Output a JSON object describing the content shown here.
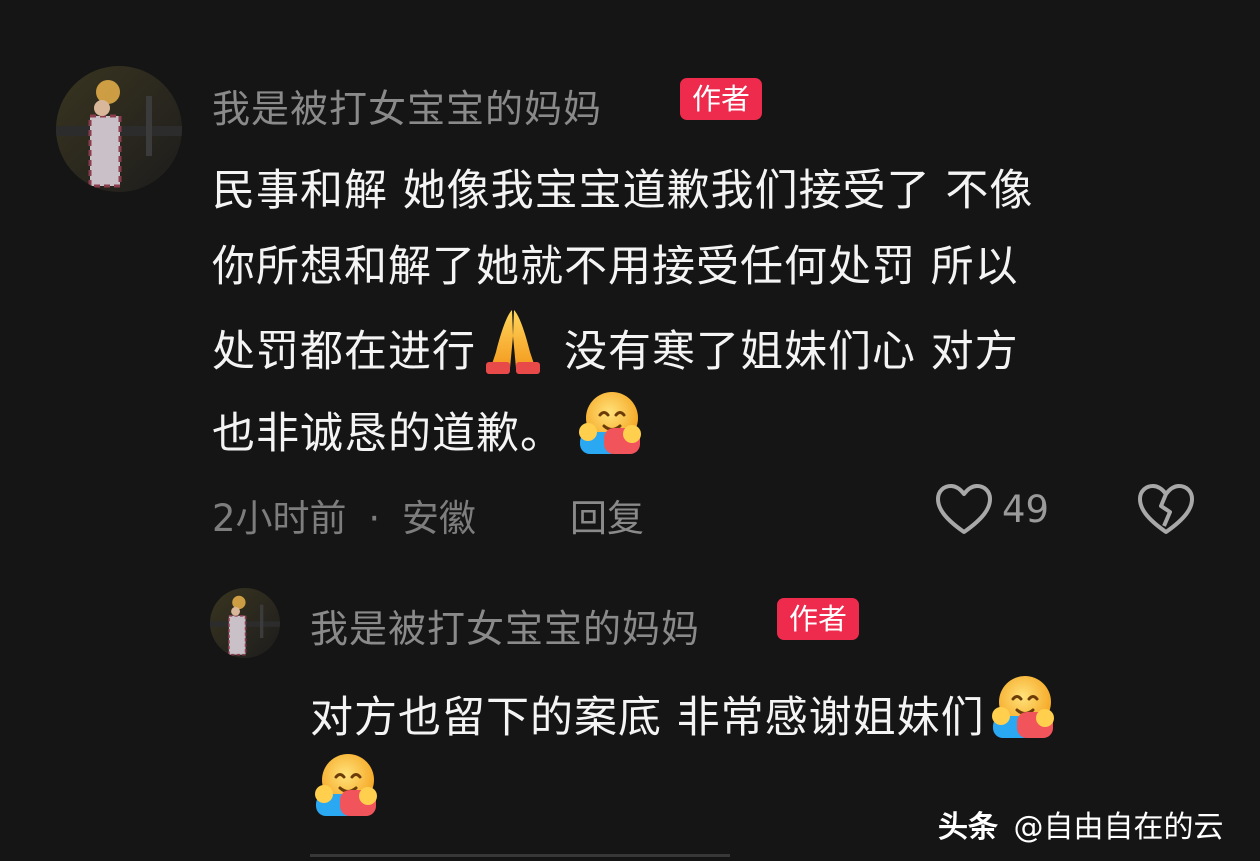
{
  "comment": {
    "username": "我是被打女宝宝的妈妈",
    "badge": "作者",
    "lines": [
      "民事和解 她像我宝宝道歉我们接受了 不像",
      "你所想和解了她就不用接受任何处罚 所以",
      "处罚都在进行",
      "没有寒了姐妹们心 对方",
      "也非诚恳的道歉。"
    ],
    "time": "2小时前",
    "separator": "·",
    "location": "安徽",
    "reply_label": "回复",
    "like_count": "49",
    "emoji": [
      "folded-hands-icon",
      "hugging-face-icon"
    ]
  },
  "reply": {
    "username": "我是被打女宝宝的妈妈",
    "badge": "作者",
    "lines": [
      "对方也留下的案底 非常感谢姐妹们"
    ],
    "emoji": [
      "hugging-face-icon",
      "hugging-face-icon"
    ]
  },
  "watermark": {
    "brand": "头条",
    "handle": "@自由自在的云"
  },
  "colors": {
    "background": "#151515",
    "badge": "#ee2a4d",
    "username": "#8a8a8a",
    "meta": "#7d7d7d"
  }
}
